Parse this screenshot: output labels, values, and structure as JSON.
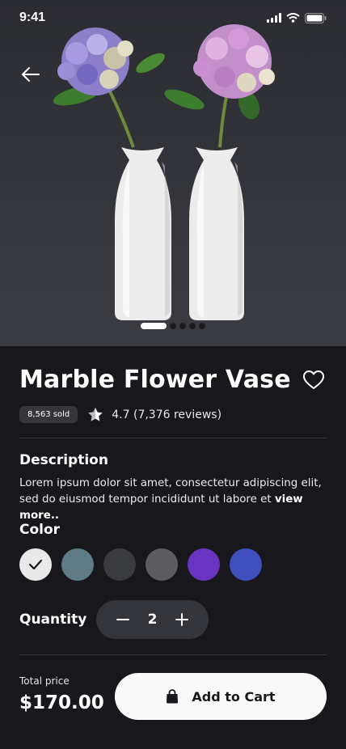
{
  "status_bar": {
    "time": "9:41"
  },
  "product": {
    "title": "Marble Flower Vase",
    "sold_badge": "8,563 sold",
    "rating_text": "4.7 (7,376 reviews)",
    "image_count": 5,
    "active_image": 1
  },
  "description": {
    "label": "Description",
    "text": "Lorem ipsum dolor sit amet, consectetur adipiscing elit, sed do eiusmod tempor incididunt ut labore et ",
    "more": "view more.."
  },
  "color": {
    "label": "Color",
    "options": [
      {
        "hex": "#e9e9e9",
        "selected": true
      },
      {
        "hex": "#5f7b87",
        "selected": false
      },
      {
        "hex": "#3b3c3f",
        "selected": false
      },
      {
        "hex": "#5d5d5f",
        "selected": false
      },
      {
        "hex": "#6a34c2",
        "selected": false
      },
      {
        "hex": "#3f4ebd",
        "selected": false
      }
    ]
  },
  "quantity": {
    "label": "Quantity",
    "value": "2"
  },
  "footer": {
    "total_label": "Total price",
    "total_value": "$170.00",
    "cart_label": "Add to Cart"
  },
  "icons": {
    "back": "arrow-left-icon",
    "favorite": "heart-icon",
    "rating": "star-icon",
    "cart": "shopping-bag-icon"
  }
}
